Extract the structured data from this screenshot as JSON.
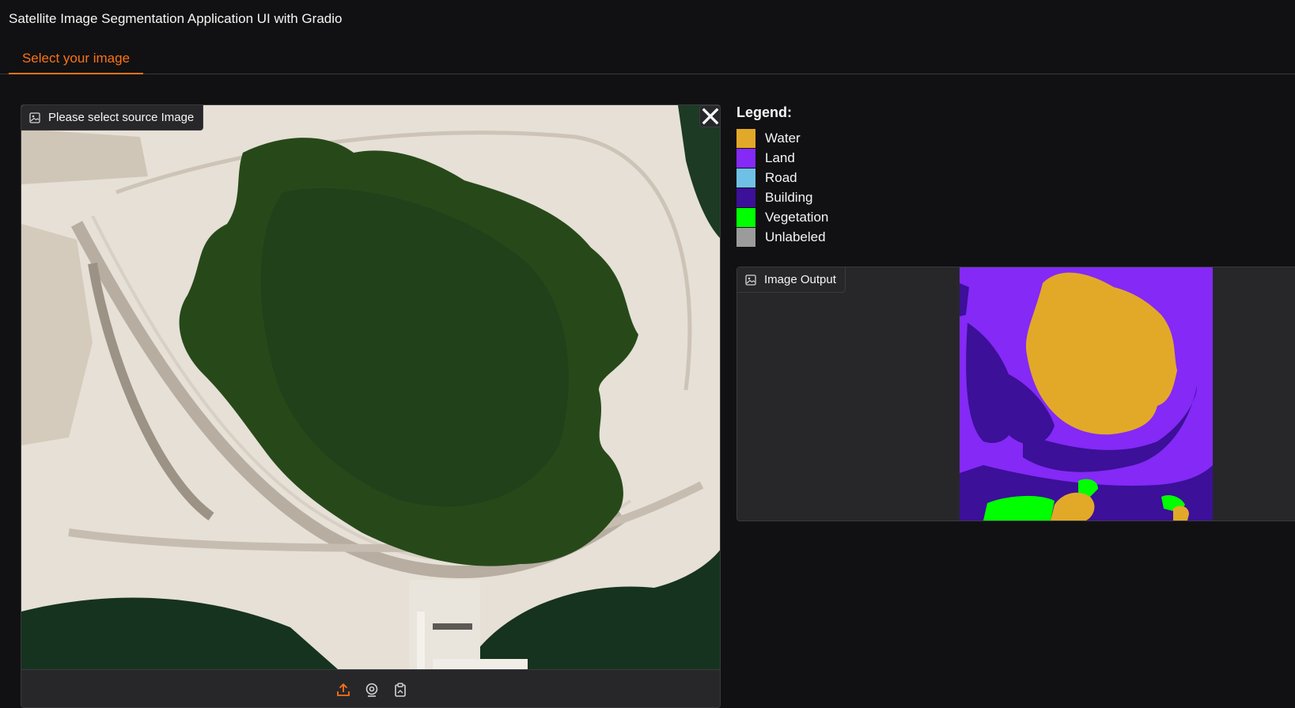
{
  "app": {
    "title": "Satellite Image Segmentation Application UI with Gradio"
  },
  "tabs": [
    {
      "label": "Select your image",
      "active": true
    }
  ],
  "source": {
    "label": "Please select source Image",
    "icons": [
      "image-icon",
      "close-icon",
      "upload-icon",
      "webcam-icon",
      "clipboard-icon"
    ]
  },
  "legend": {
    "title": "Legend:",
    "items": [
      {
        "label": "Water",
        "color": "#E2A929"
      },
      {
        "label": "Land",
        "color": "#8429F6"
      },
      {
        "label": "Road",
        "color": "#6EC1E4"
      },
      {
        "label": "Building",
        "color": "#3C1098"
      },
      {
        "label": "Vegetation",
        "color": "#00FF00"
      },
      {
        "label": "Unlabeled",
        "color": "#9B9B9B"
      }
    ]
  },
  "output": {
    "label": "Image Output"
  },
  "colors": {
    "accent": "#f97316",
    "background": "#111113",
    "panel": "#27272a",
    "border": "#3a3a3e"
  }
}
